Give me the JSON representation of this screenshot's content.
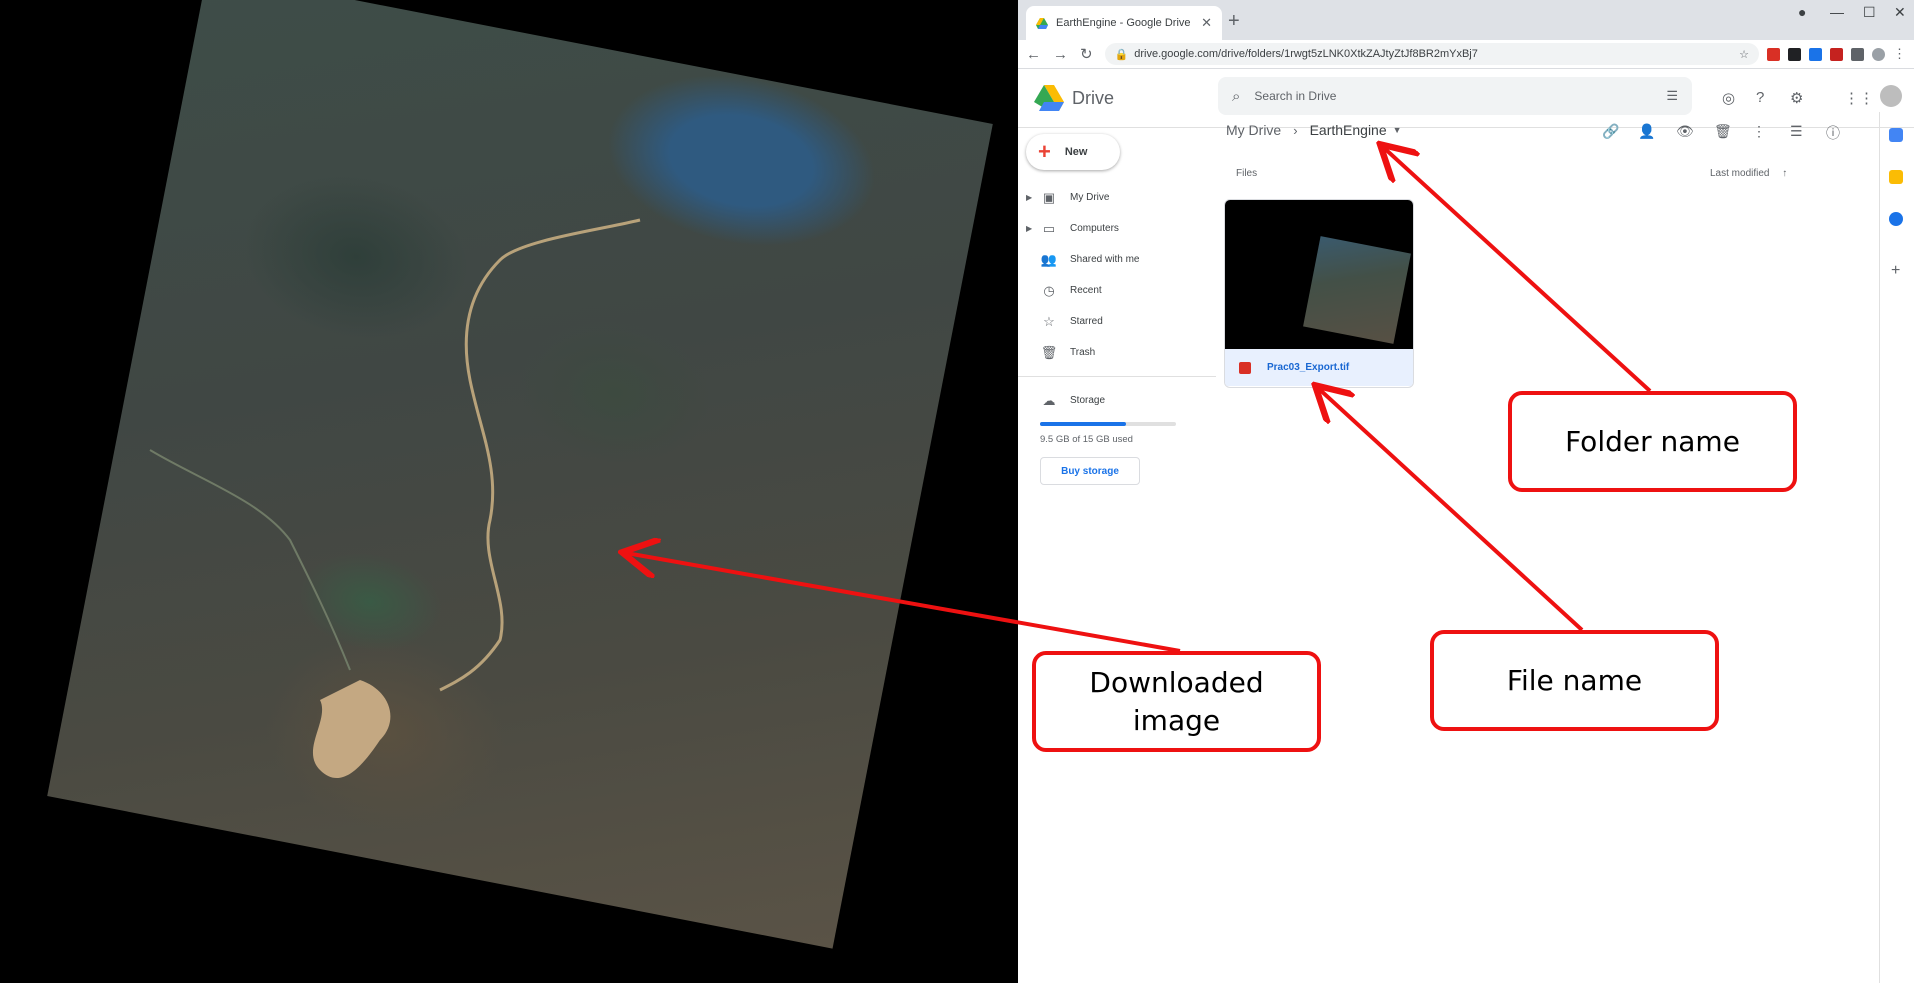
{
  "browser": {
    "tab_title": "EarthEngine - Google Drive",
    "url": "drive.google.com/drive/folders/1rwgt5zLNK0XtkZAJtyZtJf8BR2mYxBj7"
  },
  "drive": {
    "product_name": "Drive",
    "search_placeholder": "Search in Drive",
    "new_button": "New",
    "nav": [
      {
        "label": "My Drive",
        "icon": "my-drive-icon"
      },
      {
        "label": "Computers",
        "icon": "computers-icon"
      },
      {
        "label": "Shared with me",
        "icon": "shared-icon"
      },
      {
        "label": "Recent",
        "icon": "clock-icon"
      },
      {
        "label": "Starred",
        "icon": "star-icon"
      },
      {
        "label": "Trash",
        "icon": "trash-icon"
      }
    ],
    "storage": {
      "label": "Storage",
      "used_text": "9.5 GB of 15 GB used",
      "used_fraction": 0.63,
      "buy_button": "Buy storage"
    },
    "breadcrumb": {
      "root": "My Drive",
      "current": "EarthEngine"
    },
    "files_section_label": "Files",
    "sort_label": "Last modified",
    "file": {
      "name": "Prac03_Export.tif"
    }
  },
  "callouts": {
    "folder_name": "Folder name",
    "file_name": "File name",
    "downloaded_image_line1": "Downloaded",
    "downloaded_image_line2": "image"
  },
  "colors": {
    "annotation": "#ee1111",
    "accent": "#1a73e8"
  }
}
